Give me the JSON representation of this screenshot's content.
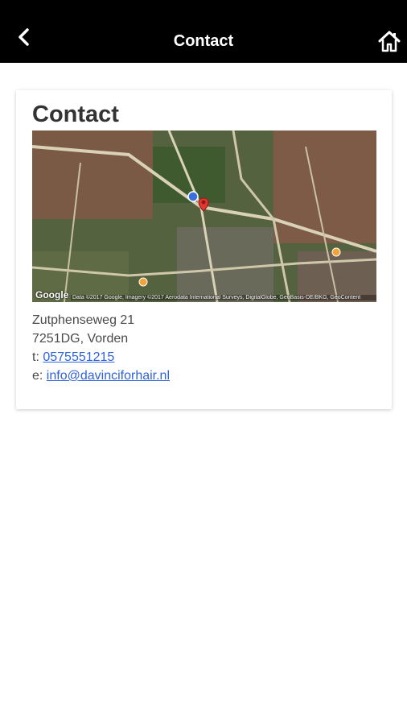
{
  "header": {
    "title": "Contact",
    "background": "#000000",
    "back_icon": "chevron-left-icon",
    "home_icon": "home-icon"
  },
  "card": {
    "title": "Contact",
    "map": {
      "google_label": "Google",
      "attribution": "Data ©2017 Google, Imagery ©2017 Aerodata International Surveys, DigitalGlobe, GeoBasis-DE/BKG, GeoContent"
    },
    "address": {
      "street": "Zutphenseweg 21",
      "city": "7251DG, Vorden",
      "phone_prefix": "t:",
      "phone": "0575551215",
      "email_prefix": "e:",
      "email": "info@davinciforhair.nl",
      "link_color": "#2f62d9"
    }
  }
}
